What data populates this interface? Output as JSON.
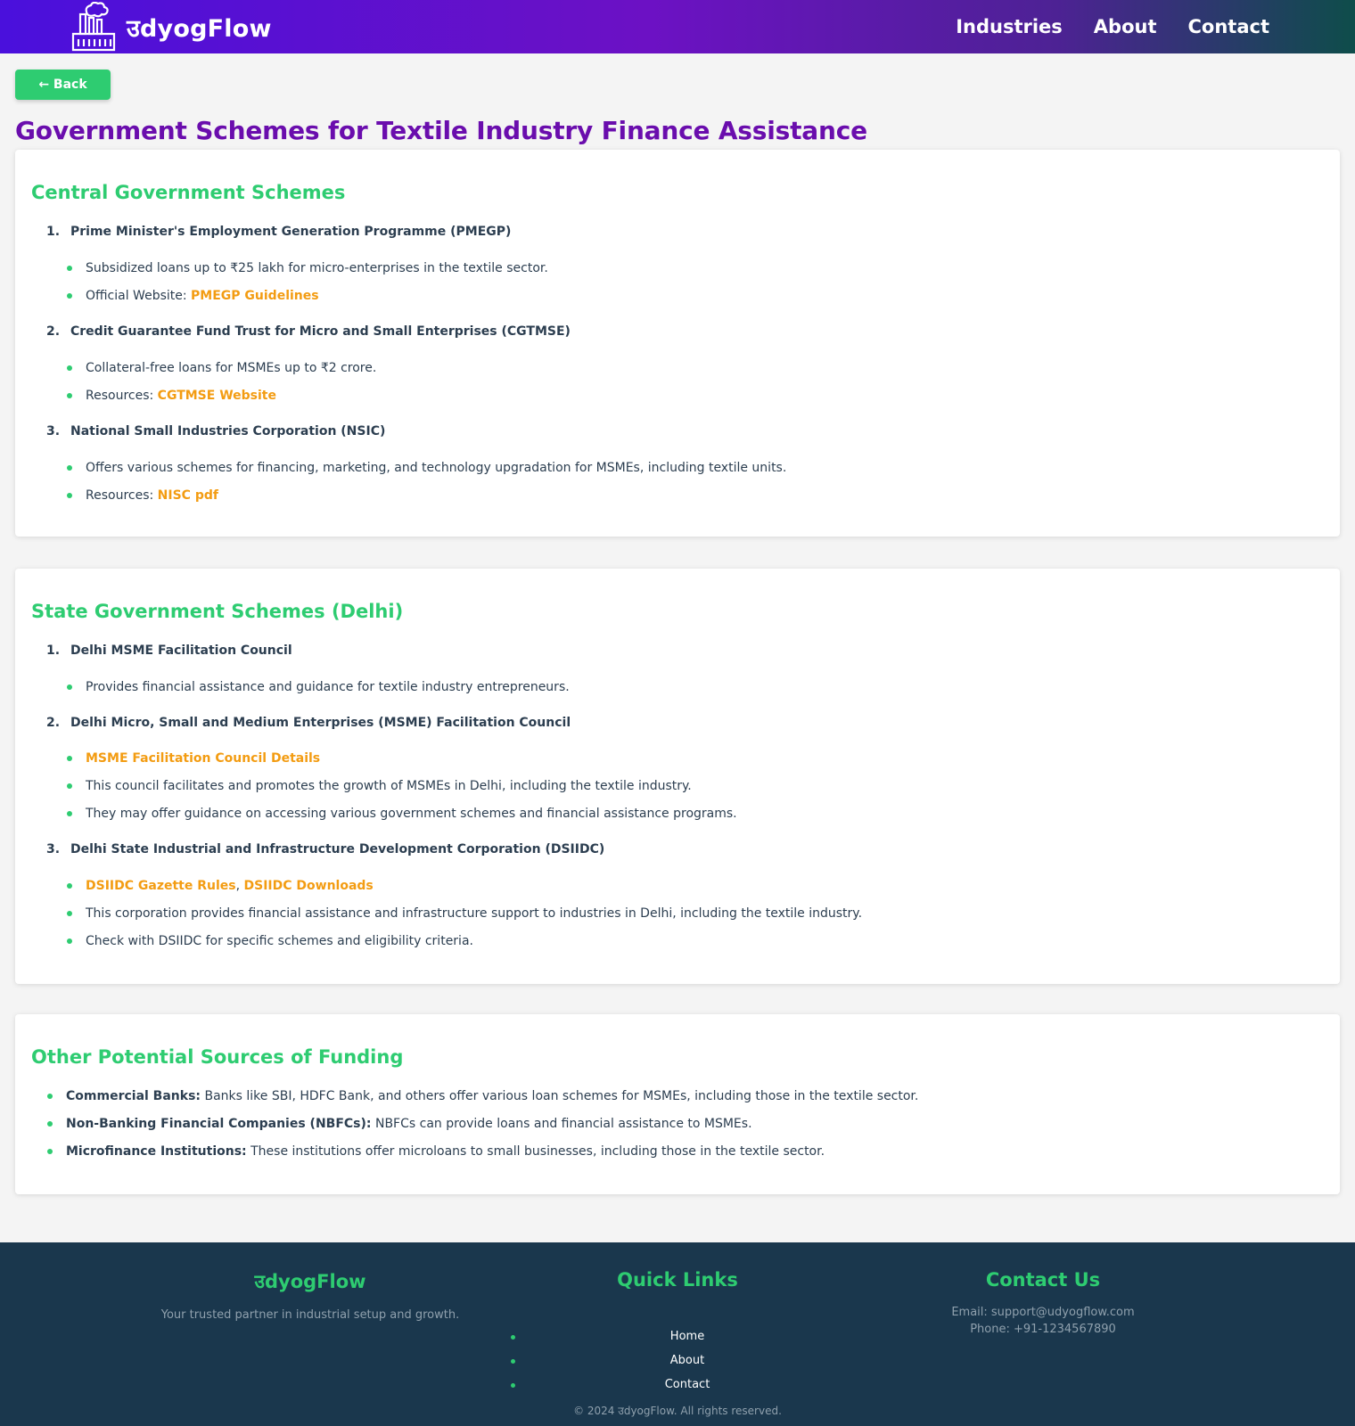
{
  "header": {
    "brand": "उdyogFlow",
    "nav": [
      "Industries",
      "About",
      "Contact"
    ]
  },
  "back_label": "← Back",
  "page_title": "Government Schemes for Textile Industry Finance Assistance",
  "central": {
    "heading": "Central Government Schemes",
    "items": [
      {
        "num": "1.",
        "title": "Prime Minister's Employment Generation Programme (PMEGP)",
        "b1": "Subsidized loans up to ₹25 lakh for micro-enterprises in the textile sector.",
        "b2_prefix": "Official Website: ",
        "b2_link": "PMEGP Guidelines"
      },
      {
        "num": "2.",
        "title": "Credit Guarantee Fund Trust for Micro and Small Enterprises (CGTMSE)",
        "b1": "Collateral-free loans for MSMEs up to ₹2 crore.",
        "b2_prefix": "Resources: ",
        "b2_link": "CGTMSE Website"
      },
      {
        "num": "3.",
        "title": "National Small Industries Corporation (NSIC)",
        "b1": "Offers various schemes for financing, marketing, and technology upgradation for MSMEs, including textile units.",
        "b2_prefix": "Resources: ",
        "b2_link": "NISC pdf"
      }
    ]
  },
  "state": {
    "heading": "State Government Schemes (Delhi)",
    "item1": {
      "num": "1.",
      "title": "Delhi MSME Facilitation Council",
      "b1": "Provides financial assistance and guidance for textile industry entrepreneurs."
    },
    "item2": {
      "num": "2.",
      "title": "Delhi Micro, Small and Medium Enterprises (MSME) Facilitation Council",
      "link": "MSME Facilitation Council Details",
      "b2": "This council facilitates and promotes the growth of MSMEs in Delhi, including the textile industry.",
      "b3": "They may offer guidance on accessing various government schemes and financial assistance programs."
    },
    "item3": {
      "num": "3.",
      "title": "Delhi State Industrial and Infrastructure Development Corporation (DSIIDC)",
      "link1": "DSIIDC Gazette Rules",
      "sep": ", ",
      "link2": "DSIIDC Downloads",
      "b2": "This corporation provides financial assistance and infrastructure support to industries in Delhi, including the textile industry.",
      "b3": "Check with DSIIDC for specific schemes and eligibility criteria."
    }
  },
  "other": {
    "heading": "Other Potential Sources of Funding",
    "items": [
      {
        "label": "Commercial Banks:",
        "text": " Banks like SBI, HDFC Bank, and others offer various loan schemes for MSMEs, including those in the textile sector."
      },
      {
        "label": "Non-Banking Financial Companies (NBFCs):",
        "text": " NBFCs can provide loans and financial assistance to MSMEs."
      },
      {
        "label": "Microfinance Institutions:",
        "text": " These institutions offer microloans to small businesses, including those in the textile sector."
      }
    ]
  },
  "footer": {
    "brand": "उdyogFlow",
    "tagline": "Your trusted partner in industrial setup and growth.",
    "quick_links_heading": "Quick Links",
    "links": [
      "Home",
      "About",
      "Contact"
    ],
    "contact_heading": "Contact Us",
    "email": "Email: support@udyogflow.com",
    "phone": "Phone: +91-1234567890",
    "copyright": "© 2024 उdyogFlow. All rights reserved."
  },
  "colors": {
    "accent_green": "#2ecc71",
    "title_purple": "#6a0dad",
    "link_orange": "#f39c12",
    "footer_bg": "#1a374d"
  },
  "icons": {
    "brand_logo": "factory-icon"
  }
}
